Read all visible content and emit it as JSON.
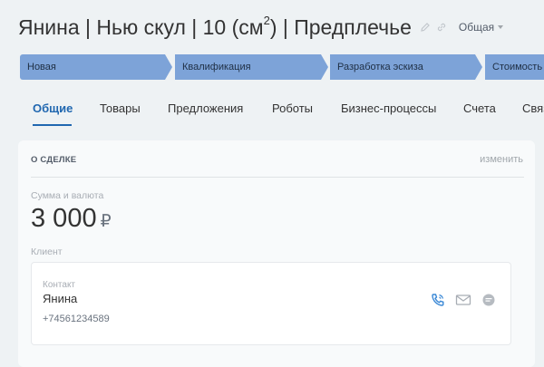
{
  "header": {
    "title_main": "Янина | Нью скул | 10 (см",
    "title_sup": "2",
    "title_tail": ") | Предплечье",
    "category": "Общая"
  },
  "stages": [
    "Новая",
    "Квалификация",
    "Разработка эскиза",
    "Стоимость"
  ],
  "tabs": [
    "Общие",
    "Товары",
    "Предложения",
    "Роботы",
    "Бизнес-процессы",
    "Счета",
    "Связ"
  ],
  "active_tab": "Общие",
  "deal": {
    "section_title": "О СДЕЛКЕ",
    "edit_label": "изменить",
    "amount_label": "Сумма и валюта",
    "amount": "3 000",
    "currency": "₽",
    "client_label": "Клиент",
    "contact_label": "Контакт",
    "contact_name": "Янина",
    "contact_phone": "+74561234589"
  },
  "colors": {
    "stage_fill": "#7da3d8",
    "accent": "#2067b0",
    "background": "#eef2f4"
  },
  "icons": [
    "pencil-icon",
    "link-icon",
    "phone-icon",
    "mail-icon",
    "chat-icon"
  ]
}
